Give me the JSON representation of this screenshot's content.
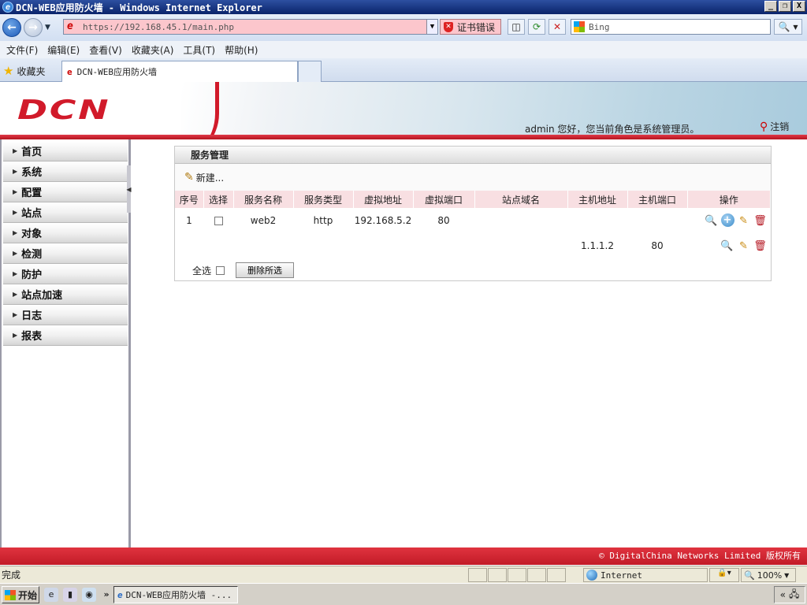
{
  "window": {
    "title": "DCN-WEB应用防火墙 - Windows Internet Explorer",
    "minimize": "_",
    "restore": "❐",
    "close": "X"
  },
  "toolbar": {
    "address": "https://192.168.45.1/main.php",
    "cert_error": "证书错误",
    "search_placeholder": "Bing"
  },
  "menu": [
    "文件(F)",
    "编辑(E)",
    "查看(V)",
    "收藏夹(A)",
    "工具(T)",
    "帮助(H)"
  ],
  "favorites": {
    "label": "收藏夹",
    "tab_title": "DCN-WEB应用防火墙"
  },
  "header": {
    "logo": "DCN",
    "welcome": "admin 您好，您当前角色是系统管理员。",
    "logout": "注销"
  },
  "sidebar": {
    "items": [
      {
        "label": "首页"
      },
      {
        "label": "系统"
      },
      {
        "label": "配置"
      },
      {
        "label": "站点"
      },
      {
        "label": "对象"
      },
      {
        "label": "检测"
      },
      {
        "label": "防护"
      },
      {
        "label": "站点加速"
      },
      {
        "label": "日志"
      },
      {
        "label": "报表"
      }
    ]
  },
  "panel": {
    "title": "服务管理",
    "new_label": "新建...",
    "columns": [
      "序号",
      "选择",
      "服务名称",
      "服务类型",
      "虚拟地址",
      "虚拟端口",
      "站点域名",
      "主机地址",
      "主机端口",
      "操作"
    ],
    "rows": [
      {
        "no": "1",
        "name": "web2",
        "type": "http",
        "vaddr": "192.168.5.2",
        "vport": "80",
        "domain": "",
        "haddr": "",
        "hport": ""
      },
      {
        "no": "",
        "name": "",
        "type": "",
        "vaddr": "",
        "vport": "",
        "domain": "",
        "haddr": "1.1.1.2",
        "hport": "80"
      }
    ],
    "select_all": "全选",
    "delete_selected": "删除所选"
  },
  "footer": {
    "copyright": "© DigitalChina Networks Limited 版权所有"
  },
  "status": {
    "text": "完成",
    "zone": "Internet",
    "zoom": "100%"
  },
  "taskbar": {
    "start": "开始",
    "item": "DCN-WEB应用防火墙 -..."
  }
}
